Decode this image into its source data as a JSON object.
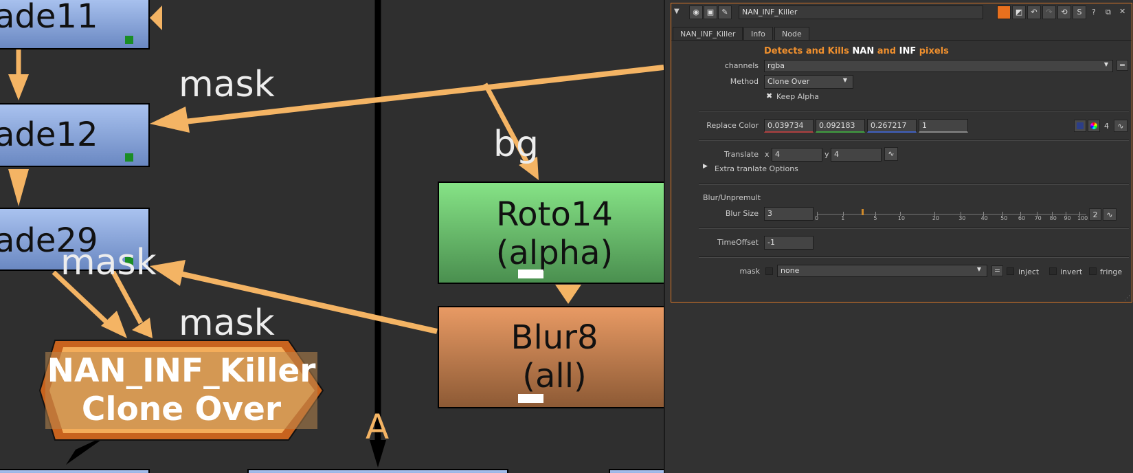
{
  "graph": {
    "nodes": {
      "grade11": "ade11",
      "grade12": "ade12",
      "grade29": "ade29",
      "roto_name": "Roto14",
      "roto_channel": "(alpha)",
      "blur_name": "Blur8",
      "blur_channel": "(all)",
      "nan_name": "NAN_INF_Killer",
      "nan_method": "Clone Over"
    },
    "labels": {
      "mask1": "mask",
      "mask2": "mask",
      "mask3": "mask",
      "bg": "bg",
      "a_input": "A"
    }
  },
  "panel": {
    "title_field": "NAN_INF_Killer",
    "tabs": [
      "NAN_INF_Killer",
      "Info",
      "Node"
    ],
    "header": {
      "p1": "Detects and Kills ",
      "p2": "NAN",
      "p3": " and ",
      "p4": "INF",
      "p5": " pixels"
    },
    "channels": {
      "label": "channels",
      "value": "rgba"
    },
    "method": {
      "label": "Method",
      "value": "Clone Over"
    },
    "keep_alpha": {
      "label": "Keep Alpha",
      "checked": true
    },
    "replace_color": {
      "label": "Replace Color",
      "r": "0.039734",
      "g": "0.092183",
      "b": "0.267217",
      "a": "1",
      "count": "4"
    },
    "translate": {
      "label": "Translate",
      "x_label": "x",
      "x": "4",
      "y_label": "y",
      "y": "4"
    },
    "extra": "Extra tranlate Options",
    "section": "Blur/Unpremult",
    "blur_size": {
      "label": "Blur Size",
      "value": "3",
      "ticks": [
        "0",
        "1",
        "5",
        "10",
        "20",
        "30",
        "40",
        "50",
        "60",
        "70",
        "80",
        "90",
        "100"
      ],
      "slider_value": 3,
      "count": "2"
    },
    "time_offset": {
      "label": "TimeOffset",
      "value": "-1"
    },
    "mask": {
      "label": "mask",
      "value": "none",
      "inject": "inject",
      "invert": "invert",
      "fringe": "fringe"
    },
    "colors": {
      "accent": "#f0902e",
      "highlight": "#ffffff",
      "panel_border": "#e07a28"
    }
  }
}
